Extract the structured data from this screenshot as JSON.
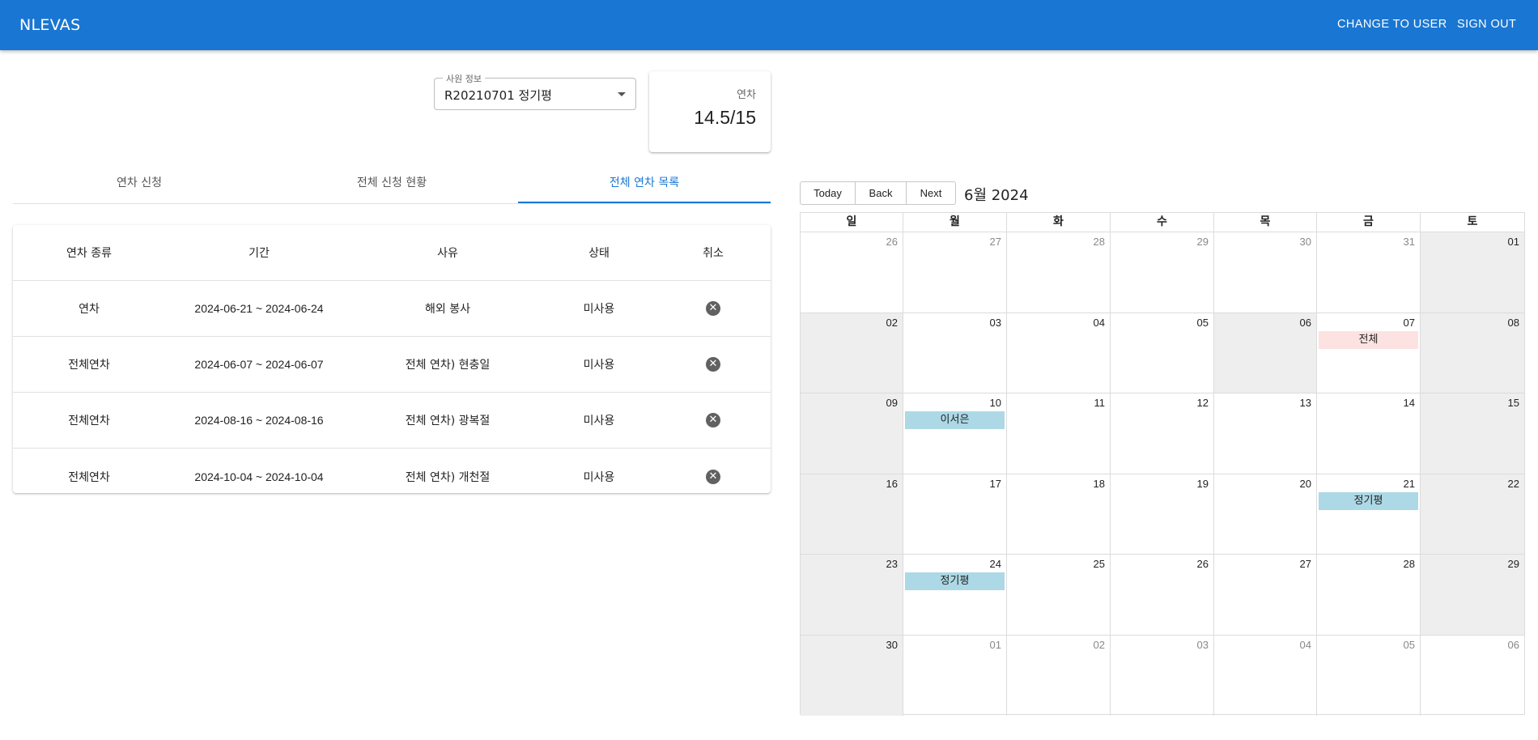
{
  "appbar": {
    "brand": "NLEVAS",
    "change_user": "CHANGE TO USER",
    "sign_out": "SIGN OUT"
  },
  "employee_select": {
    "legend": "사원 정보",
    "value": "R20210701 정기평"
  },
  "leave_card": {
    "label": "연차",
    "value": "14.5/15"
  },
  "tabs": [
    {
      "label": "연차 신청",
      "active": false
    },
    {
      "label": "전체 신청 현황",
      "active": false
    },
    {
      "label": "전체 연차 목록",
      "active": true
    }
  ],
  "table": {
    "headers": [
      "연차 종류",
      "기간",
      "사유",
      "상태",
      "취소"
    ],
    "rows": [
      {
        "type": "연차",
        "period": "2024-06-21 ~ 2024-06-24",
        "reason": "해외 봉사",
        "status": "미사용",
        "cancel_icon": "✕"
      },
      {
        "type": "전체연차",
        "period": "2024-06-07 ~ 2024-06-07",
        "reason": "전체 연차) 현충일",
        "status": "미사용",
        "cancel_icon": "✕"
      },
      {
        "type": "전체연차",
        "period": "2024-08-16 ~ 2024-08-16",
        "reason": "전체 연차) 광복절",
        "status": "미사용",
        "cancel_icon": "✕"
      },
      {
        "type": "전체연차",
        "period": "2024-10-04 ~ 2024-10-04",
        "reason": "전체 연차) 개천절",
        "status": "미사용",
        "cancel_icon": "✕"
      }
    ]
  },
  "calendar": {
    "buttons": {
      "today": "Today",
      "back": "Back",
      "next": "Next"
    },
    "label": "6월 2024",
    "weekdays": [
      "일",
      "월",
      "화",
      "수",
      "목",
      "금",
      "토"
    ],
    "weeks": [
      [
        {
          "num": "26",
          "off": true,
          "weekend": false
        },
        {
          "num": "27",
          "off": true,
          "weekend": false
        },
        {
          "num": "28",
          "off": true,
          "weekend": false
        },
        {
          "num": "29",
          "off": true,
          "weekend": false
        },
        {
          "num": "30",
          "off": true,
          "weekend": false
        },
        {
          "num": "31",
          "off": true,
          "weekend": false
        },
        {
          "num": "01",
          "off": false,
          "weekend": true
        }
      ],
      [
        {
          "num": "02",
          "off": false,
          "weekend": true
        },
        {
          "num": "03",
          "off": false,
          "weekend": false
        },
        {
          "num": "04",
          "off": false,
          "weekend": false
        },
        {
          "num": "05",
          "off": false,
          "weekend": false
        },
        {
          "num": "06",
          "off": false,
          "weekend": true
        },
        {
          "num": "07",
          "off": false,
          "weekend": false,
          "event": {
            "label": "전체",
            "color": "#fde2e2"
          }
        },
        {
          "num": "08",
          "off": false,
          "weekend": true
        }
      ],
      [
        {
          "num": "09",
          "off": false,
          "weekend": true
        },
        {
          "num": "10",
          "off": false,
          "weekend": false,
          "event": {
            "label": "이서은",
            "color": "#add8e6"
          }
        },
        {
          "num": "11",
          "off": false,
          "weekend": false
        },
        {
          "num": "12",
          "off": false,
          "weekend": false
        },
        {
          "num": "13",
          "off": false,
          "weekend": false
        },
        {
          "num": "14",
          "off": false,
          "weekend": false
        },
        {
          "num": "15",
          "off": false,
          "weekend": true
        }
      ],
      [
        {
          "num": "16",
          "off": false,
          "weekend": true
        },
        {
          "num": "17",
          "off": false,
          "weekend": false
        },
        {
          "num": "18",
          "off": false,
          "weekend": false
        },
        {
          "num": "19",
          "off": false,
          "weekend": false
        },
        {
          "num": "20",
          "off": false,
          "weekend": false
        },
        {
          "num": "21",
          "off": false,
          "weekend": false,
          "event": {
            "label": "정기평",
            "color": "#add8e6"
          }
        },
        {
          "num": "22",
          "off": false,
          "weekend": true
        }
      ],
      [
        {
          "num": "23",
          "off": false,
          "weekend": true
        },
        {
          "num": "24",
          "off": false,
          "weekend": false,
          "event": {
            "label": "정기평",
            "color": "#add8e6"
          }
        },
        {
          "num": "25",
          "off": false,
          "weekend": false
        },
        {
          "num": "26",
          "off": false,
          "weekend": false
        },
        {
          "num": "27",
          "off": false,
          "weekend": false
        },
        {
          "num": "28",
          "off": false,
          "weekend": false
        },
        {
          "num": "29",
          "off": false,
          "weekend": true
        }
      ],
      [
        {
          "num": "30",
          "off": false,
          "weekend": true
        },
        {
          "num": "01",
          "off": true,
          "weekend": false
        },
        {
          "num": "02",
          "off": true,
          "weekend": false
        },
        {
          "num": "03",
          "off": true,
          "weekend": false
        },
        {
          "num": "04",
          "off": true,
          "weekend": false
        },
        {
          "num": "05",
          "off": true,
          "weekend": false
        },
        {
          "num": "06",
          "off": true,
          "weekend": false
        }
      ]
    ]
  },
  "colors": {
    "primary": "#1976d2",
    "weekend_bg": "#eeeeee",
    "event_blue": "#add8e6",
    "event_pink": "#fde2e2"
  }
}
